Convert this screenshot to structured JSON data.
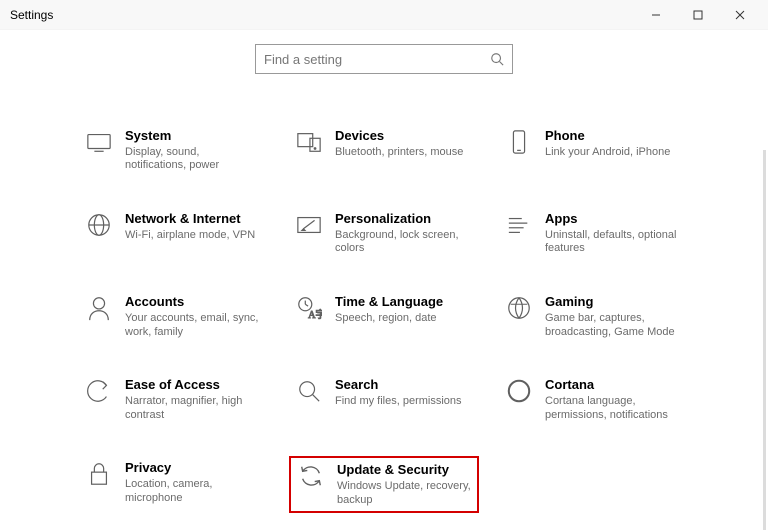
{
  "window": {
    "title": "Settings"
  },
  "search": {
    "placeholder": "Find a setting"
  },
  "tiles": [
    {
      "icon": "system-icon",
      "title": "System",
      "desc": "Display, sound, notifications, power"
    },
    {
      "icon": "devices-icon",
      "title": "Devices",
      "desc": "Bluetooth, printers, mouse"
    },
    {
      "icon": "phone-icon",
      "title": "Phone",
      "desc": "Link your Android, iPhone"
    },
    {
      "icon": "network-icon",
      "title": "Network & Internet",
      "desc": "Wi-Fi, airplane mode, VPN"
    },
    {
      "icon": "personalize-icon",
      "title": "Personalization",
      "desc": "Background, lock screen, colors"
    },
    {
      "icon": "apps-icon",
      "title": "Apps",
      "desc": "Uninstall, defaults, optional features"
    },
    {
      "icon": "accounts-icon",
      "title": "Accounts",
      "desc": "Your accounts, email, sync, work, family"
    },
    {
      "icon": "time-icon",
      "title": "Time & Language",
      "desc": "Speech, region, date"
    },
    {
      "icon": "gaming-icon",
      "title": "Gaming",
      "desc": "Game bar, captures, broadcasting, Game Mode"
    },
    {
      "icon": "ease-icon",
      "title": "Ease of Access",
      "desc": "Narrator, magnifier, high contrast"
    },
    {
      "icon": "search-cat-icon",
      "title": "Search",
      "desc": "Find my files, permissions"
    },
    {
      "icon": "cortana-icon",
      "title": "Cortana",
      "desc": "Cortana language, permissions, notifications"
    },
    {
      "icon": "privacy-icon",
      "title": "Privacy",
      "desc": "Location, camera, microphone"
    },
    {
      "icon": "update-icon",
      "title": "Update & Security",
      "desc": "Windows Update, recovery, backup",
      "highlight": true
    }
  ]
}
